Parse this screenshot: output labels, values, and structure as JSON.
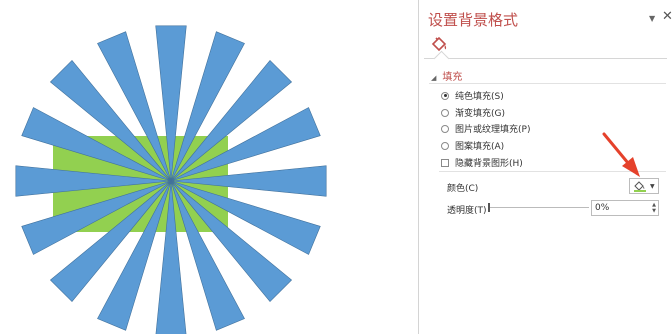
{
  "pane": {
    "title": "设置背景格式",
    "section_fill": "填充",
    "options": [
      {
        "label": "纯色填充(S)",
        "selected": true
      },
      {
        "label": "渐变填充(G)",
        "selected": false
      },
      {
        "label": "图片或纹理填充(P)",
        "selected": false
      },
      {
        "label": "图案填充(A)",
        "selected": false
      }
    ],
    "hide_background_graphics": "隐藏背景图形(H)",
    "color_label": "颜色(C)",
    "transparency_label": "透明度(T)",
    "transparency_value": "0%",
    "transparency": 0
  },
  "colors": {
    "accent_title": "#c0504d",
    "starburst": "#5b9bd5",
    "rectangle": "#92d050",
    "annotation_arrow": "#e5412b"
  },
  "icons": {
    "fill_tab": "paint-bucket-icon",
    "close": "close-icon",
    "dropdown": "chevron-down-icon",
    "color_picker": "paint-bucket-icon"
  }
}
